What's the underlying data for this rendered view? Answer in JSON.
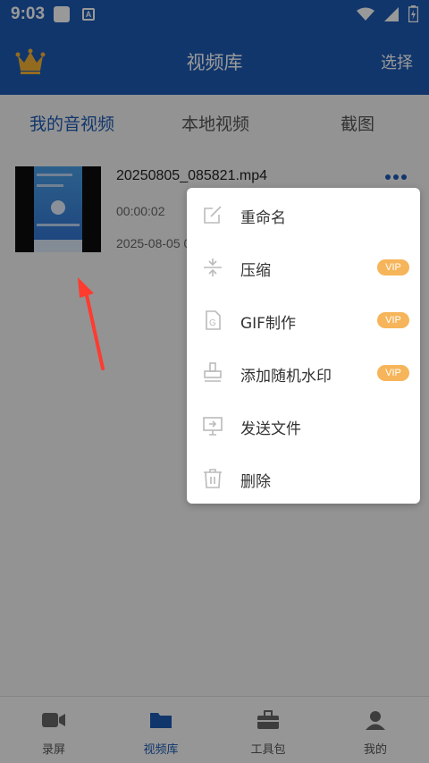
{
  "status_bar": {
    "time": "9:03",
    "icons": [
      "square-icon",
      "a-icon",
      "wifi-icon",
      "signal-icon",
      "battery-icon"
    ]
  },
  "header": {
    "title": "视频库",
    "select_label": "选择",
    "crown_icon": "crown-icon"
  },
  "tabs": [
    {
      "label": "我的音视频",
      "active": true
    },
    {
      "label": "本地视频",
      "active": false
    },
    {
      "label": "截图",
      "active": false
    }
  ],
  "video": {
    "filename": "20250805_085821.mp4",
    "duration": "00:00:02",
    "date": "2025-08-05 0"
  },
  "menu": {
    "items": [
      {
        "label": "重命名",
        "icon": "edit-icon",
        "vip": false
      },
      {
        "label": "压缩",
        "icon": "compress-icon",
        "vip": true
      },
      {
        "label": "GIF制作",
        "icon": "gif-icon",
        "vip": true
      },
      {
        "label": "添加随机水印",
        "icon": "stamp-icon",
        "vip": true
      },
      {
        "label": "发送文件",
        "icon": "send-icon",
        "vip": false
      },
      {
        "label": "删除",
        "icon": "trash-icon",
        "vip": false
      }
    ],
    "vip_label": "VIP"
  },
  "bottom_nav": [
    {
      "label": "录屏",
      "icon": "camera-icon",
      "active": false
    },
    {
      "label": "视频库",
      "icon": "folder-icon",
      "active": true
    },
    {
      "label": "工具包",
      "icon": "toolbox-icon",
      "active": false
    },
    {
      "label": "我的",
      "icon": "user-icon",
      "active": false
    }
  ],
  "colors": {
    "primary": "#1d5bb5",
    "vip": "#f6b55a",
    "arrow": "#ff3b30"
  }
}
